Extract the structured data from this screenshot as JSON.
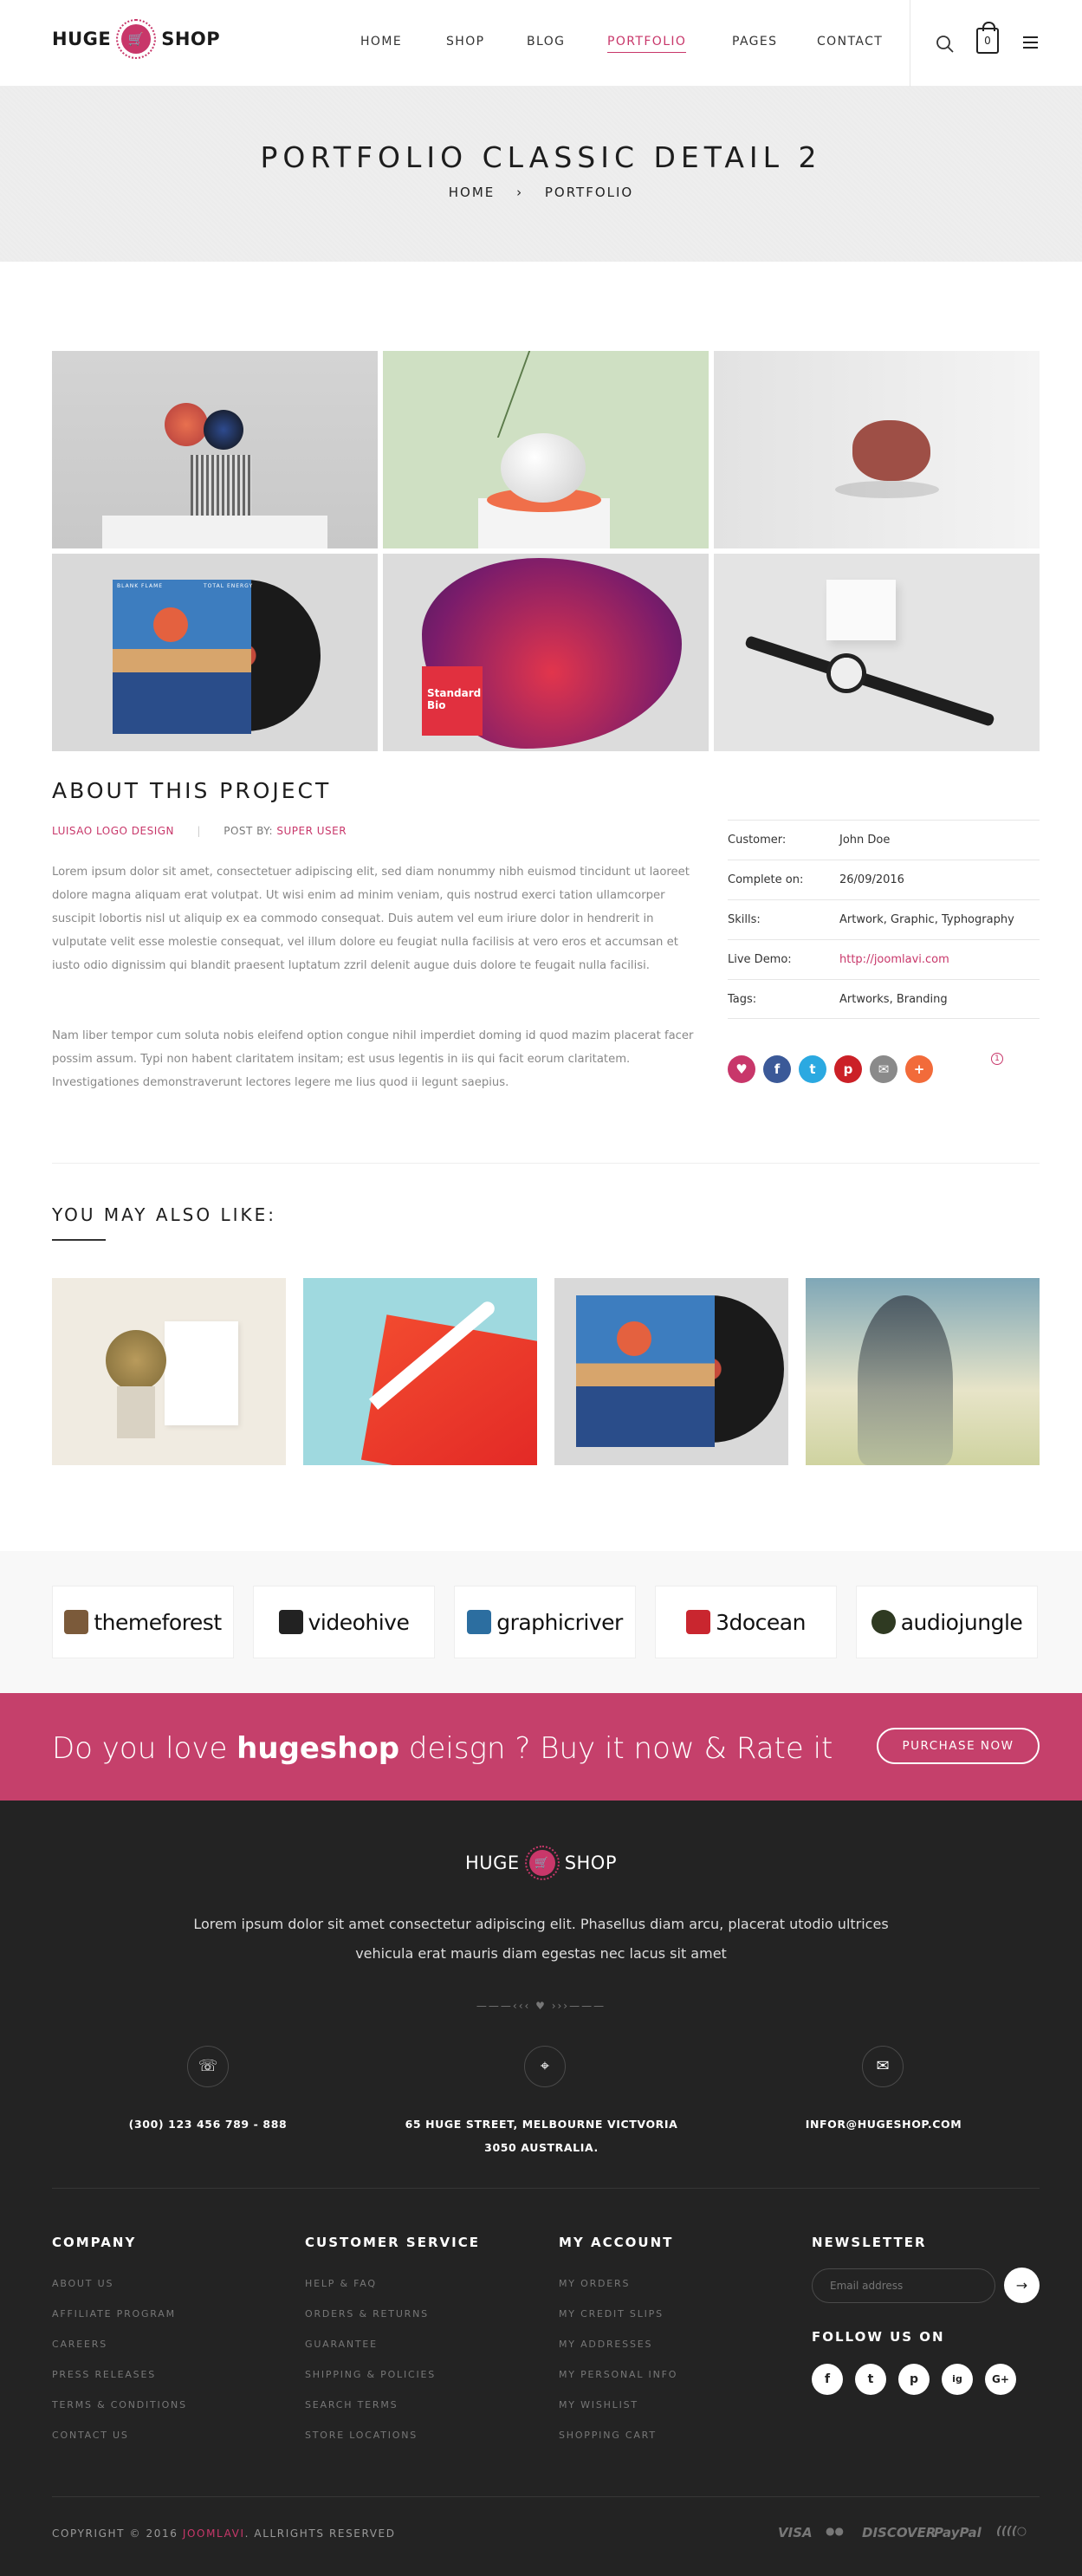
{
  "header": {
    "logo_left": "HUGE",
    "logo_right": "SHOP",
    "nav": [
      "HOME",
      "SHOP",
      "BLOG",
      "PORTFOLIO",
      "PAGES",
      "CONTACT"
    ],
    "active_nav": "PORTFOLIO",
    "cart_count": "0"
  },
  "title_band": {
    "title": "PORTFOLIO CLASSIC DETAIL 2",
    "crumb_home": "HOME",
    "crumb_sep": "›",
    "crumb_current": "PORTFOLIO"
  },
  "gallery": {
    "record_cover_left": "BLANK FLAME",
    "record_cover_right": "TOTAL ENERGY",
    "blob_label_1": "Standard",
    "blob_label_2": "Bio"
  },
  "about": {
    "heading": "ABOUT THIS PROJECT",
    "category": "LUISAO LOGO DESIGN",
    "posted_by_label": "POST BY:",
    "author": "SUPER USER",
    "paragraph_1": "Lorem ipsum dolor sit amet, consectetuer adipiscing elit, sed diam nonummy nibh euismod tincidunt ut laoreet dolore magna aliquam erat volutpat. Ut wisi enim ad minim veniam, quis nostrud exerci tation ullamcorper suscipit lobortis nisl ut aliquip ex ea commodo consequat. Duis autem vel eum iriure dolor in hendrerit in vulputate velit esse molestie consequat, vel illum dolore eu feugiat nulla facilisis at vero eros et accumsan et iusto odio dignissim qui blandit praesent luptatum zzril delenit augue duis dolore te feugait nulla facilisi.",
    "paragraph_2": "Nam liber tempor cum soluta nobis eleifend option congue nihil imperdiet doming id quod mazim placerat facer possim assum. Typi non habent claritatem insitam; est usus legentis in iis qui facit eorum claritatem. Investigationes demonstraverunt lectores legere me lius quod ii legunt saepius.",
    "info": [
      {
        "key": "Customer:",
        "value": "John Doe"
      },
      {
        "key": "Complete on:",
        "value": "26/09/2016"
      },
      {
        "key": "Skills:",
        "value": "Artwork, Graphic, Typhography"
      },
      {
        "key": "Live Demo:",
        "value": "http://joomlavi.com"
      },
      {
        "key": "Tags:",
        "value": "Artworks, Branding"
      }
    ],
    "like_count": "1",
    "share_icons": [
      "heart-icon",
      "facebook-icon",
      "twitter-icon",
      "pinterest-icon",
      "email-icon",
      "plus-icon"
    ]
  },
  "related": {
    "heading": "YOU MAY ALSO LIKE:"
  },
  "brands": [
    "themeforest",
    "videohive",
    "graphicriver",
    "3docean",
    "audiojungle"
  ],
  "cta": {
    "text_before": "Do you love ",
    "text_bold": "hugeshop",
    "text_after": " deisgn ? Buy it now & Rate it",
    "button": "PURCHASE NOW"
  },
  "footer": {
    "logo_left": "HUGE",
    "logo_right": "SHOP",
    "description": "Lorem ipsum dolor sit amet consectetur adipiscing elit. Phasellus diam arcu, placerat utodio ultrices vehicula erat mauris diam egestas nec lacus sit amet",
    "phone": "(300) 123 456 789 - 888",
    "address_1": "65 HUGE STREET, MELBOURNE VICTVORIA",
    "address_2": "3050 AUSTRALIA.",
    "email": "INFOR@HUGESHOP.COM",
    "columns": [
      {
        "title": "COMPANY",
        "links": [
          "ABOUT US",
          "AFFILIATE PROGRAM",
          "CAREERS",
          "PRESS RELEASES",
          "TERMS & CONDITIONS",
          "CONTACT US"
        ]
      },
      {
        "title": "CUSTOMER SERVICE",
        "links": [
          "HELP & FAQ",
          "ORDERS & RETURNS",
          "GUARANTEE",
          "SHIPPING & POLICIES",
          "SEARCH TERMS",
          "STORE LOCATIONS"
        ]
      },
      {
        "title": "MY ACCOUNT",
        "links": [
          "MY ORDERS",
          "MY CREDIT SLIPS",
          "MY ADDRESSES",
          "MY PERSONAL INFO",
          "MY WISHLIST",
          "SHOPPING CART"
        ]
      }
    ],
    "newsletter_title": "NEWSLETTER",
    "newsletter_placeholder": "Email address",
    "follow_title": "FOLLOW US ON",
    "social": [
      "f",
      "t",
      "p",
      "ig",
      "G+"
    ],
    "copyright_before": "COPYRIGHT © 2016 ",
    "copyright_brand": "JOOMLAVI",
    "copyright_after": ". ALLRIGHTS RESERVED",
    "payments": [
      "VISA",
      "●●",
      "DISCOVER",
      "PayPal",
      "((((○"
    ]
  },
  "colors": {
    "accent": "#c8376a",
    "cta_bg": "#c5406b",
    "footer_bg": "#232323"
  }
}
